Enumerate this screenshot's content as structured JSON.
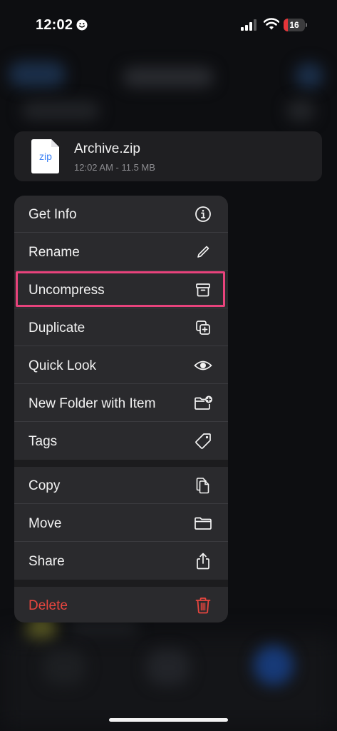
{
  "status_bar": {
    "time": "12:02",
    "battery": "16",
    "battery_color": "#e5363a"
  },
  "file": {
    "icon_label": "zip",
    "name": "Archive.zip",
    "meta": "12:02 AM - 11.5 MB"
  },
  "menu": {
    "items": [
      {
        "label": "Get Info",
        "icon": "info-circle-icon"
      },
      {
        "label": "Rename",
        "icon": "pencil-icon"
      },
      {
        "label": "Uncompress",
        "icon": "archive-box-icon"
      },
      {
        "label": "Duplicate",
        "icon": "duplicate-icon"
      },
      {
        "label": "Quick Look",
        "icon": "eye-icon"
      },
      {
        "label": "New Folder with Item",
        "icon": "folder-plus-icon"
      },
      {
        "label": "Tags",
        "icon": "tag-icon"
      },
      {
        "label": "Copy",
        "icon": "copy-documents-icon"
      },
      {
        "label": "Move",
        "icon": "folder-icon"
      },
      {
        "label": "Share",
        "icon": "share-icon"
      },
      {
        "label": "Delete",
        "icon": "trash-icon"
      }
    ],
    "highlighted_item": "Uncompress",
    "highlight_color": "#e8437c",
    "delete_color": "#e8463f"
  }
}
